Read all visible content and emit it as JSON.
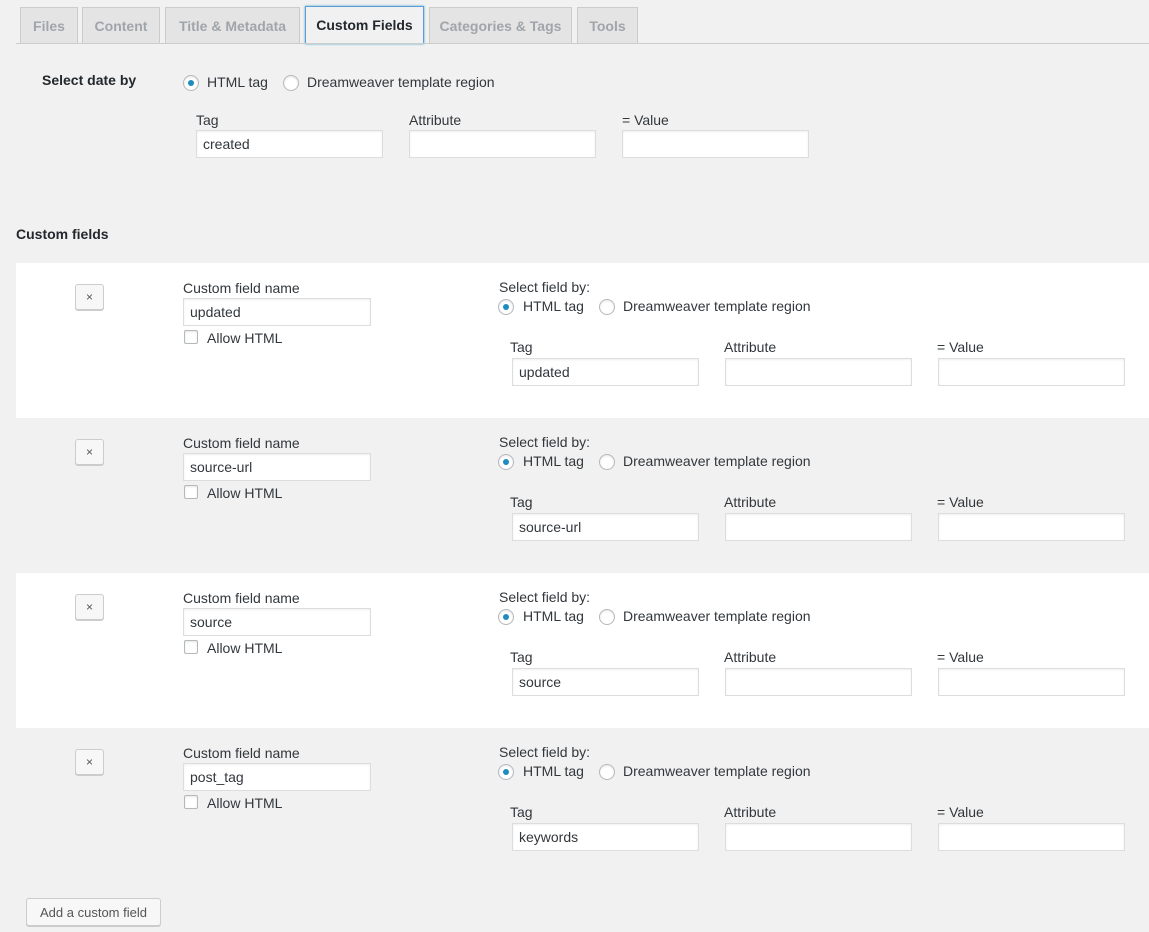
{
  "tabs": [
    {
      "label": "Files",
      "active": false
    },
    {
      "label": "Content",
      "active": false
    },
    {
      "label": "Title & Metadata",
      "active": false
    },
    {
      "label": "Custom Fields",
      "active": true
    },
    {
      "label": "Categories & Tags",
      "active": false
    },
    {
      "label": "Tools",
      "active": false
    }
  ],
  "date_section": {
    "label": "Select date by",
    "option_html": "HTML tag",
    "option_dw": "Dreamweaver template region",
    "selected": "html",
    "tag_label": "Tag",
    "tag_value": "created",
    "attr_label": "Attribute",
    "attr_value": "",
    "value_label": "= Value",
    "value_value": ""
  },
  "custom_fields_heading": "Custom fields",
  "field_labels": {
    "remove": "×",
    "name_label": "Custom field name",
    "allow_html": "Allow HTML",
    "select_by": "Select field by:",
    "option_html": "HTML tag",
    "option_dw": "Dreamweaver template region",
    "tag_label": "Tag",
    "attr_label": "Attribute",
    "value_label": "= Value"
  },
  "fields": [
    {
      "name": "updated",
      "allow_html": false,
      "selected": "html",
      "tag": "updated",
      "attribute": "",
      "value": ""
    },
    {
      "name": "source-url",
      "allow_html": false,
      "selected": "html",
      "tag": "source-url",
      "attribute": "",
      "value": ""
    },
    {
      "name": "source",
      "allow_html": false,
      "selected": "html",
      "tag": "source",
      "attribute": "",
      "value": ""
    },
    {
      "name": "post_tag",
      "allow_html": false,
      "selected": "html",
      "tag": "keywords",
      "attribute": "",
      "value": ""
    }
  ],
  "add_button": "Add a custom field"
}
